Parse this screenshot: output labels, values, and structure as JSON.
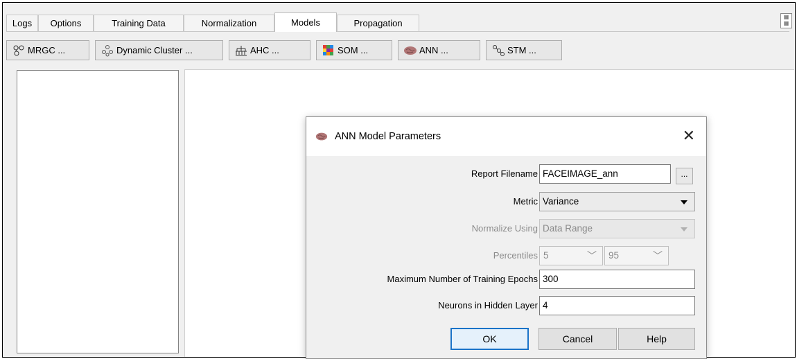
{
  "tabs": [
    {
      "label": "Logs"
    },
    {
      "label": "Options"
    },
    {
      "label": "Training Data"
    },
    {
      "label": "Normalization"
    },
    {
      "label": "Models",
      "active": true
    },
    {
      "label": "Propagation"
    }
  ],
  "toolbar": {
    "buttons": [
      {
        "label": "MRGC ...",
        "icon": "network-icon"
      },
      {
        "label": "Dynamic Cluster ...",
        "icon": "cluster-icon"
      },
      {
        "label": "AHC ...",
        "icon": "hierarchy-icon"
      },
      {
        "label": "SOM ...",
        "icon": "grid-map-icon"
      },
      {
        "label": "ANN ...",
        "icon": "brain-icon"
      },
      {
        "label": "STM ...",
        "icon": "nodes-icon"
      }
    ]
  },
  "dialog": {
    "title": "ANN Model Parameters",
    "fields": {
      "report_filename": {
        "label": "Report Filename",
        "value": "FACEIMAGE_ann",
        "browse_label": "..."
      },
      "metric": {
        "label": "Metric",
        "value": "Variance"
      },
      "normalize": {
        "label": "Normalize Using",
        "value": "Data Range"
      },
      "percentiles": {
        "label": "Percentiles",
        "low": "5",
        "high": "95"
      },
      "epochs": {
        "label": "Maximum Number of Training Epochs",
        "value": "300"
      },
      "neurons": {
        "label": "Neurons in Hidden Layer",
        "value": "4"
      }
    },
    "buttons": {
      "ok": "OK",
      "cancel": "Cancel",
      "help": "Help"
    }
  },
  "colors": {
    "accent": "#1a73c8",
    "panel": "#f0f0f0",
    "disabled_text": "#8a8a8a"
  }
}
